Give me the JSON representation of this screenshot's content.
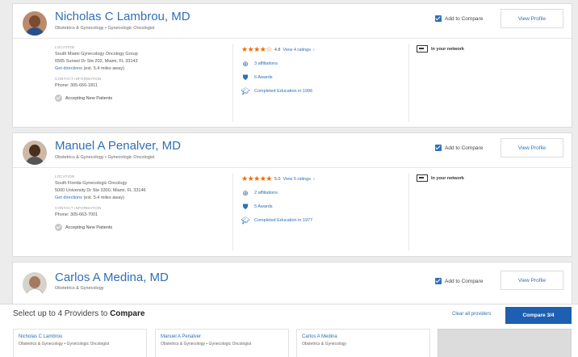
{
  "providers": [
    {
      "name": "Nicholas C Lambrou, MD",
      "specialties": "Obstetrics & Gynecology  •  Gynecologic Oncologist",
      "compare_label": "Add to Compare",
      "view_profile": "View Profile",
      "location_label": "LOCATION",
      "practice": "South Miami Gynecology Oncology Group",
      "address": "6565 Sunset Dr Ste 202, Miami, FL 33143",
      "directions_link": "Get directions",
      "distance": "(est. 5.4 miles away)",
      "contact_label": "CONTACT INFORMATION",
      "phone": "Phone: 305-666-1811",
      "accepting": "Accepting New Patients",
      "stars": "★★★★☆",
      "rating": "4.8",
      "ratings_link": "View 4 ratings",
      "affiliations": "3 affiliations",
      "awards": "6 Awards",
      "education": "Completed Education in 1996",
      "network": "In your network"
    },
    {
      "name": "Manuel A Penalver, MD",
      "specialties": "Obstetrics & Gynecology  •  Gynecologic Oncologist",
      "compare_label": "Add to Compare",
      "view_profile": "View Profile",
      "location_label": "LOCATION",
      "practice": "South Florida Gynecologic Oncology",
      "address": "5000 University Dr Ste 3300, Miami, FL 33146",
      "directions_link": "Get directions",
      "distance": "(est. 5.4 miles away)",
      "contact_label": "CONTACT INFORMATION",
      "phone": "Phone: 305-663-7001",
      "accepting": "Accepting New Patients",
      "stars": "★★★★★",
      "rating": "5.0",
      "ratings_link": "View 5 ratings",
      "affiliations": "2 affiliations",
      "awards": "5 Awards",
      "education": "Completed Education in 1977",
      "network": "In your network"
    },
    {
      "name": "Carlos A Medina, MD",
      "specialties": "Obstetrics & Gynecology",
      "compare_label": "Add to Compare",
      "view_profile": "View Profile"
    }
  ],
  "compare_bar": {
    "title_prefix": "Select up to 4 Providers to ",
    "title_bold": "Compare",
    "clear_link": "Clear all providers",
    "compare_button": "Compare 3/4",
    "slots": [
      {
        "name": "Nicholas C Lambrou",
        "spec": "Obstetrics & Gynecology  •  Gynecologic Oncologist"
      },
      {
        "name": "Manuel A Penalver",
        "spec": "Obstetrics & Gynecology  •  Gynecologic Oncologist"
      },
      {
        "name": "Carlos A Medina",
        "spec": "Obstetrics & Gynecology"
      }
    ]
  }
}
